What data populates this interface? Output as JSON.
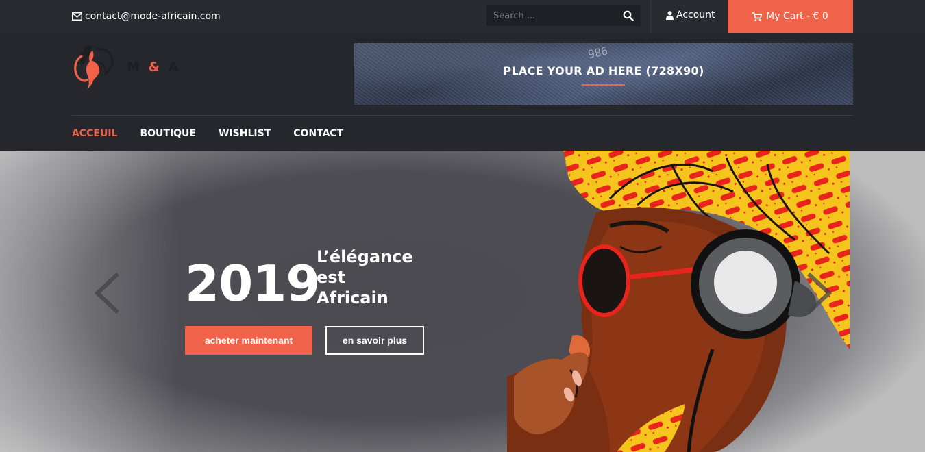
{
  "topbar": {
    "email": "contact@mode-africain.com",
    "search_placeholder": "Search ...",
    "account_label": "Account",
    "cart_label": "My Cart - € 0"
  },
  "header": {
    "logo_text_m": "M ",
    "logo_text_amp": "&",
    "logo_text_a": " A",
    "ad_text": "PLACE YOUR AD HERE (728X90)",
    "ad_stitch": "986"
  },
  "nav": {
    "items": [
      {
        "label": "ACCEUIL",
        "active": true
      },
      {
        "label": "BOUTIQUE",
        "active": false
      },
      {
        "label": "WISHLIST",
        "active": false
      },
      {
        "label": "CONTACT",
        "active": false
      }
    ]
  },
  "hero": {
    "year": "2019",
    "tagline_line1": "L’élégance",
    "tagline_line2": "est",
    "tagline_line3": "Africain",
    "primary_button": "acheter maintenant",
    "secondary_button": "en savoir plus"
  },
  "colors": {
    "accent": "#f0634a",
    "topbar_bg": "#2a2b31",
    "header_bg": "#26272d"
  },
  "icons": {
    "email": "envelope-icon",
    "search": "search-icon",
    "account": "user-icon",
    "cart": "shopping-cart-icon",
    "prev": "chevron-left-icon",
    "next": "chevron-right-icon"
  }
}
